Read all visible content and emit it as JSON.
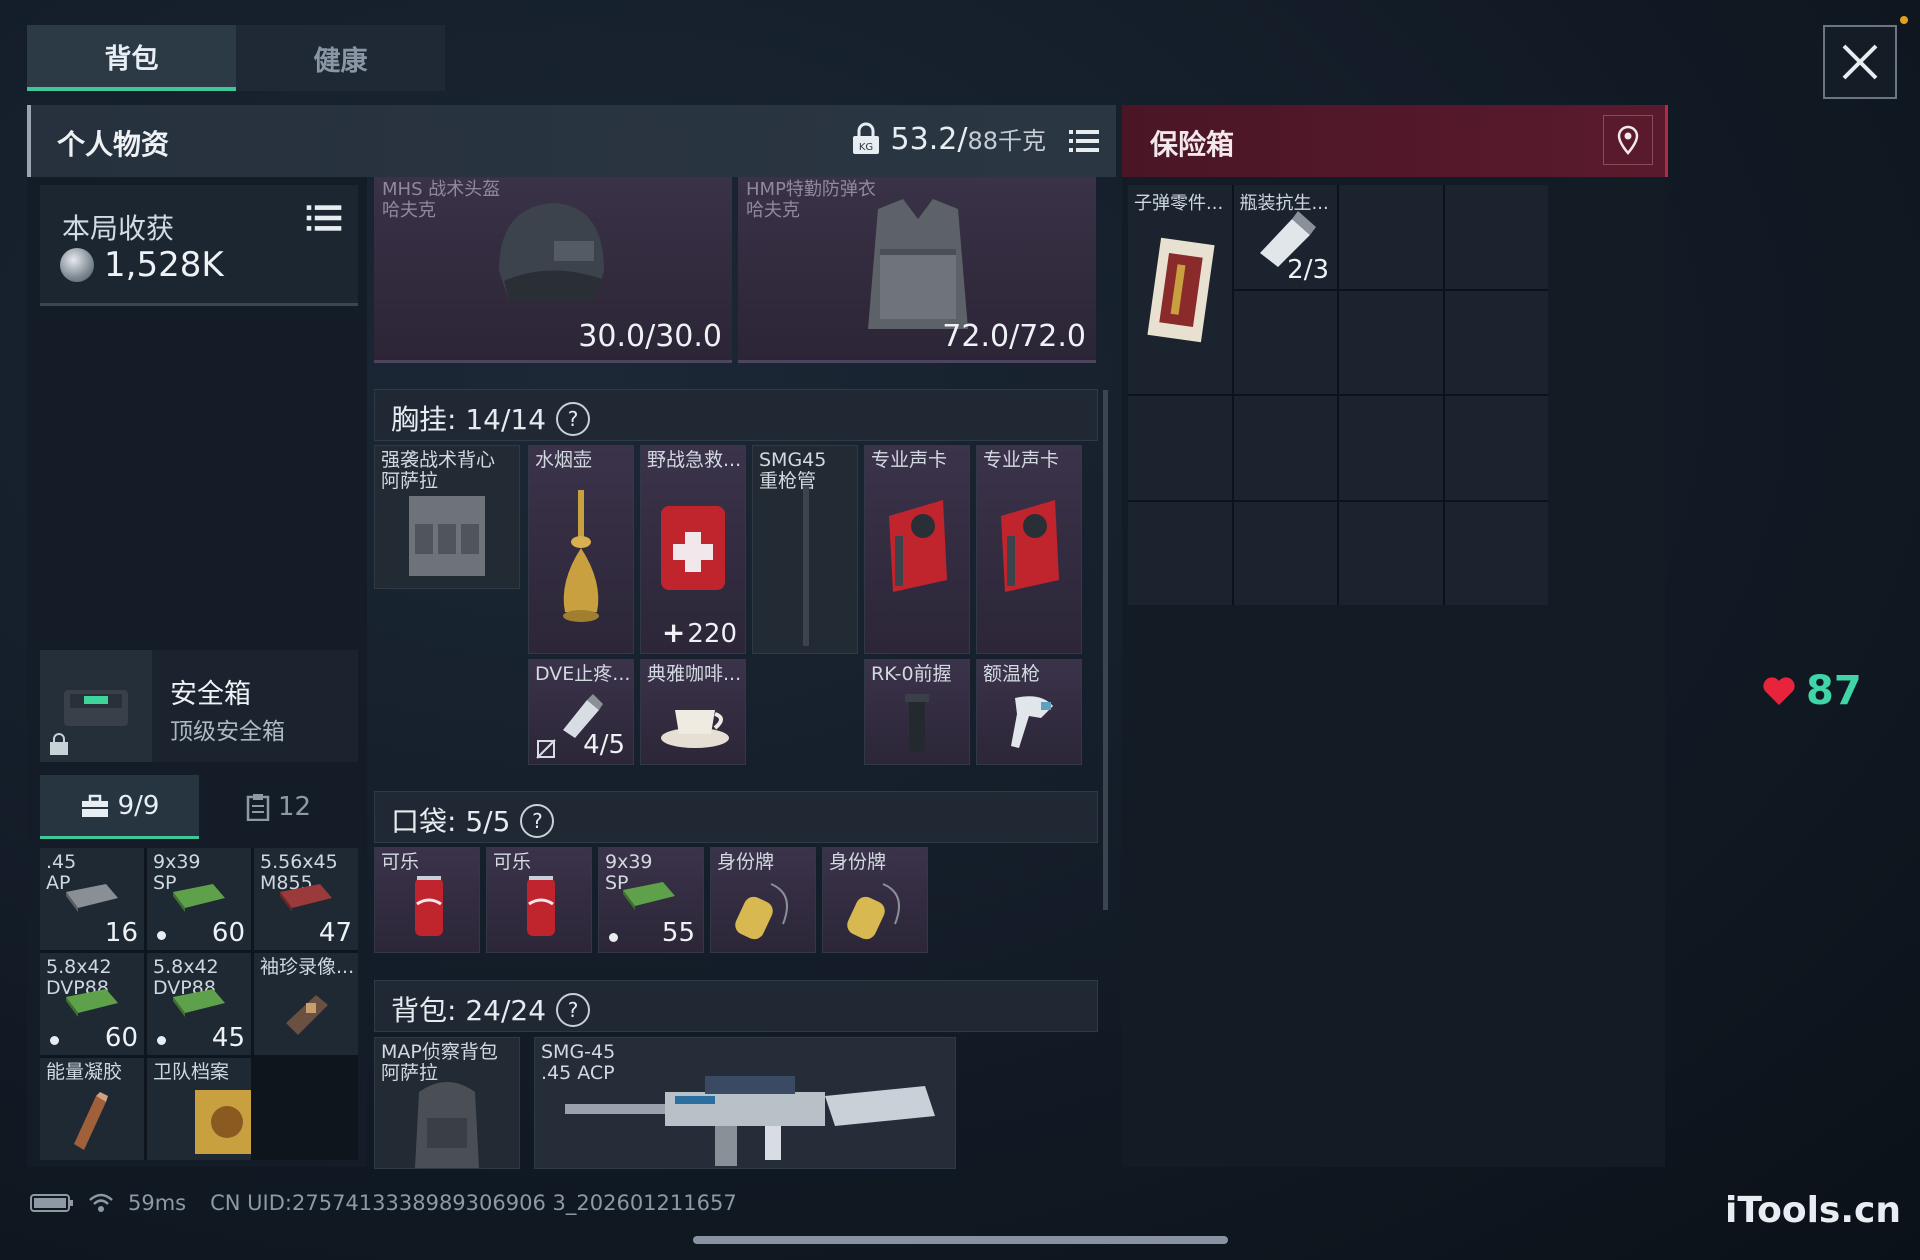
{
  "tabs": [
    {
      "label": "背包",
      "active": true
    },
    {
      "label": "健康",
      "active": false
    }
  ],
  "personal": {
    "title": "个人物资",
    "weight": "53.2/",
    "capacity": "88千克"
  },
  "safebox_header": {
    "title": "保险箱"
  },
  "earnings": {
    "label": "本局收获",
    "value": "1,528K"
  },
  "safebox_card": {
    "name": "安全箱",
    "subtitle": "顶级安全箱"
  },
  "mini_tabs": [
    {
      "label": "9/9",
      "icon": "toolbox-icon"
    },
    {
      "label": "12",
      "icon": "clipboard-icon"
    }
  ],
  "ammo": [
    {
      "name": ".45\nAP",
      "count": "16",
      "dot": false,
      "color": "#8a8f96"
    },
    {
      "name": "9x39\nSP",
      "count": "60",
      "dot": true,
      "color": "#5fa04a"
    },
    {
      "name": "5.56x45\nM855",
      "count": "47",
      "dot": false,
      "color": "#9a3a3a"
    },
    {
      "name": "5.8x42\nDVP88",
      "count": "60",
      "dot": true,
      "color": "#5fa04a"
    },
    {
      "name": "5.8x42\nDVP88",
      "count": "45",
      "dot": true,
      "color": "#5fa04a"
    },
    {
      "name": "袖珍录像...",
      "count": "",
      "dot": false,
      "color": "#6a5040"
    },
    {
      "name": "能量凝胶",
      "count": "",
      "dot": false,
      "color": "#a0603a"
    },
    {
      "name": "卫队档案",
      "count": "",
      "dot": false,
      "color": "#c9a040"
    },
    {
      "name": "",
      "count": "",
      "dot": false,
      "color": "#1f2934"
    }
  ],
  "gear": [
    {
      "name": "MHS 战术头盔\n哈夫克",
      "durability": "30.0/30.0"
    },
    {
      "name": "HMP特勤防弹衣\n哈夫克",
      "durability": "72.0/72.0"
    }
  ],
  "chest": {
    "label": "胸挂:",
    "value": "14/14",
    "help": "?"
  },
  "chest_items": [
    {
      "name": "强袭战术背心\n阿萨拉",
      "count": ""
    },
    {
      "name": "水烟壶",
      "count": ""
    },
    {
      "name": "野战急救...",
      "count": "220"
    },
    {
      "name": "SMG45\n重枪管",
      "count": ""
    },
    {
      "name": "专业声卡",
      "count": ""
    },
    {
      "name": "专业声卡",
      "count": ""
    },
    {
      "name": "DVE止疼...",
      "count": "4/5"
    },
    {
      "name": "典雅咖啡...",
      "count": ""
    },
    {
      "name": "RK-0前握",
      "count": ""
    },
    {
      "name": "额温枪",
      "count": ""
    }
  ],
  "pocket": {
    "label": "口袋:",
    "value": "5/5",
    "help": "?"
  },
  "pocket_items": [
    {
      "name": "可乐",
      "count": ""
    },
    {
      "name": "可乐",
      "count": ""
    },
    {
      "name": "9x39\nSP",
      "count": "55"
    },
    {
      "name": "身份牌",
      "count": ""
    },
    {
      "name": "身份牌",
      "count": ""
    }
  ],
  "backpack": {
    "label": "背包:",
    "value": "24/24",
    "help": "?"
  },
  "backpack_items": [
    {
      "name": "MAP侦察背包\n阿萨拉"
    },
    {
      "name": "SMG-45\n.45 ACP"
    }
  ],
  "safe_items": [
    {
      "name": "子弹零件...",
      "count": ""
    },
    {
      "name": "瓶装抗生...",
      "count": "2/3"
    }
  ],
  "status": {
    "ping": "59ms",
    "uid": "CN UID:2757413338989306906 3_202601211657"
  },
  "health": {
    "value": "87"
  },
  "watermark": "iTools.cn",
  "colors": {
    "accent": "#3fc79a",
    "safe_red": "#b32a45",
    "health_green": "#3fd5a7",
    "heart_red": "#e8243c"
  }
}
